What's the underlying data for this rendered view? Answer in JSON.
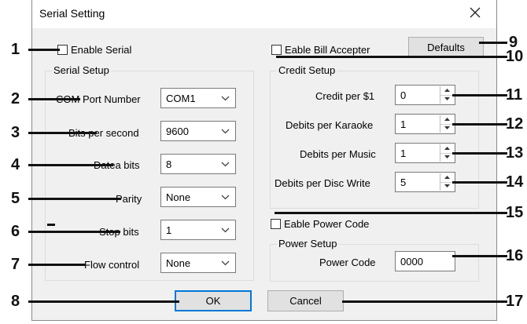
{
  "window": {
    "title": "Serial Setting"
  },
  "enable_serial": {
    "label": "Enable Serial"
  },
  "serial_setup": {
    "legend": "Serial Setup",
    "fields": [
      {
        "label": "COM Port Number",
        "value": "COM1"
      },
      {
        "label": "Bits per second",
        "value": "9600"
      },
      {
        "label": "Datea bits",
        "value": "8"
      },
      {
        "label": "Parity",
        "value": "None"
      },
      {
        "label": "Stop bits",
        "value": "1"
      },
      {
        "label": "Flow control",
        "value": "None"
      }
    ]
  },
  "bill_accepter": {
    "label": "Eable Bill Accepter"
  },
  "defaults_button": {
    "label": "Defaults"
  },
  "credit_setup": {
    "legend": "Credit Setup",
    "fields": [
      {
        "label": "Credit per $1",
        "value": "0"
      },
      {
        "label": "Debits per Karaoke",
        "value": "1"
      },
      {
        "label": "Debits per Music",
        "value": "1"
      },
      {
        "label": "Debits per Disc Write",
        "value": "5"
      }
    ]
  },
  "power_code": {
    "label": "Eable Power Code"
  },
  "power_setup": {
    "legend": "Power Setup",
    "field": {
      "label": "Power Code",
      "value": "0000"
    }
  },
  "ok_button": {
    "label": "OK"
  },
  "cancel_button": {
    "label": "Cancel"
  },
  "callouts": [
    "1",
    "2",
    "3",
    "4",
    "5",
    "6",
    "7",
    "8",
    "9",
    "10",
    "11",
    "12",
    "13",
    "14",
    "15",
    "16",
    "17"
  ],
  "colors": {
    "dialog_bg": "#f0f0f0",
    "default_button_border": "#0078d7",
    "leader_line": "#111111"
  },
  "icons": {
    "close": "close-icon",
    "dropdown": "chevron-down-icon",
    "spin_up": "spin-up-icon",
    "spin_down": "spin-down-icon"
  }
}
